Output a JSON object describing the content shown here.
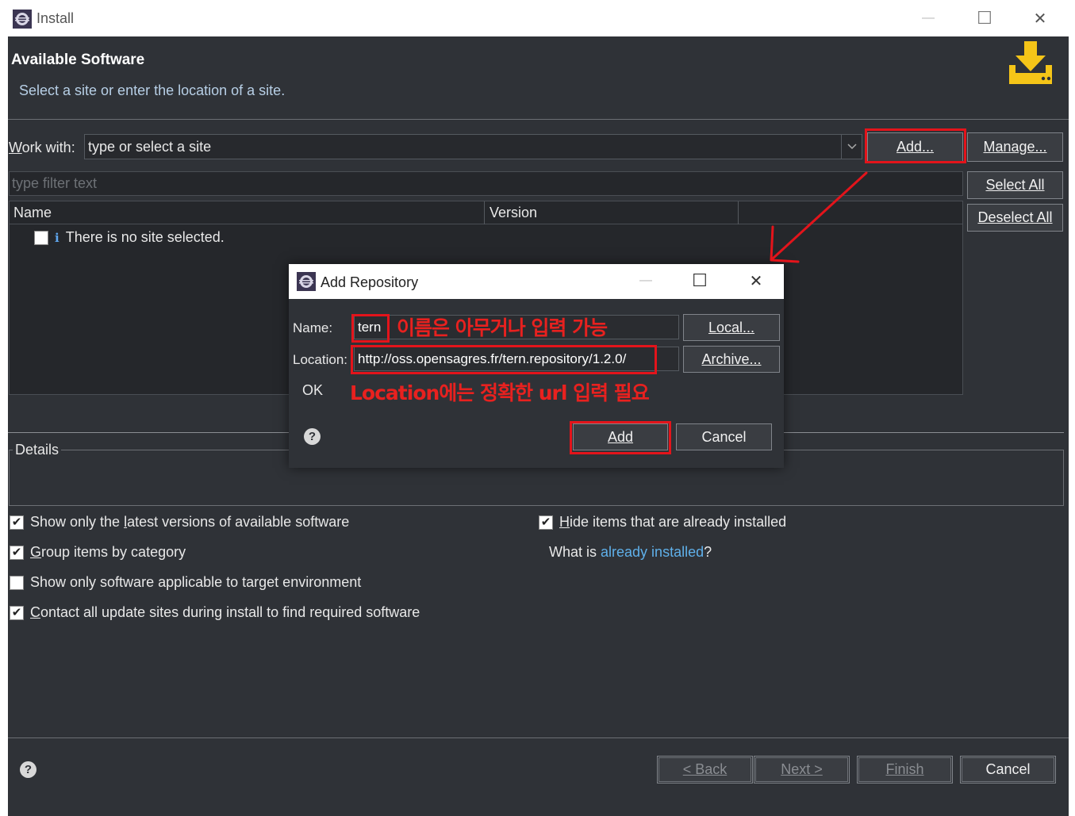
{
  "window": {
    "title": "Install",
    "minimize_glyph": "—",
    "maximize_glyph": "☐",
    "close_glyph": "✕"
  },
  "header": {
    "title": "Available Software",
    "subtitle": "Select a site or enter the location of a site.",
    "icon": "download-icon"
  },
  "work_with": {
    "label_first": "W",
    "label_rest": "ork with:",
    "value": "type or select a site",
    "add_button": "Add...",
    "manage_button": "Manage..."
  },
  "filter": {
    "placeholder": "type filter text",
    "select_all": "Select All",
    "deselect_all": "Deselect All"
  },
  "table": {
    "columns": [
      "Name",
      "Version",
      ""
    ],
    "empty_message": "There is no site selected."
  },
  "details": {
    "label": "Details"
  },
  "options": {
    "latest_versions": {
      "label_pre": "Show only the ",
      "label_ul": "l",
      "label_post": "atest versions of available software",
      "checked": true
    },
    "group_by_category": {
      "label_pre": "",
      "label_ul": "G",
      "label_post": "roup items by category",
      "checked": true
    },
    "target_env": {
      "label_pre": "Show only software applicable to target environment",
      "label_ul": "",
      "label_post": "",
      "checked": false
    },
    "contact_sites": {
      "label_pre": "",
      "label_ul": "C",
      "label_post": "ontact all update sites during install to find required software",
      "checked": true
    },
    "hide_installed": {
      "label_pre": "",
      "label_ul": "H",
      "label_post": "ide items that are already installed",
      "checked": true
    },
    "what_is_pre": "What is ",
    "already_installed_link": "already installed",
    "what_is_post": "?"
  },
  "footer": {
    "back": "< Back",
    "next": "Next >",
    "finish": "Finish",
    "cancel": "Cancel"
  },
  "dialog": {
    "title": "Add Repository",
    "name_label": "Name:",
    "name_value": "tern",
    "location_label": "Location:",
    "location_value": "http://oss.opensagres.fr/tern.repository/1.2.0/",
    "local_button": "Local...",
    "archive_button": "Archive...",
    "status": "OK",
    "add_button": "Add",
    "cancel_button": "Cancel"
  },
  "annotations": {
    "name_note": "이름은 아무거나 입력 가능",
    "location_note": "Location에는 정확한 url 입력 필요"
  },
  "colors": {
    "annotation_red": "#e3141b",
    "accent_link": "#5fb0ea",
    "icon_yellow": "#f5c518"
  }
}
